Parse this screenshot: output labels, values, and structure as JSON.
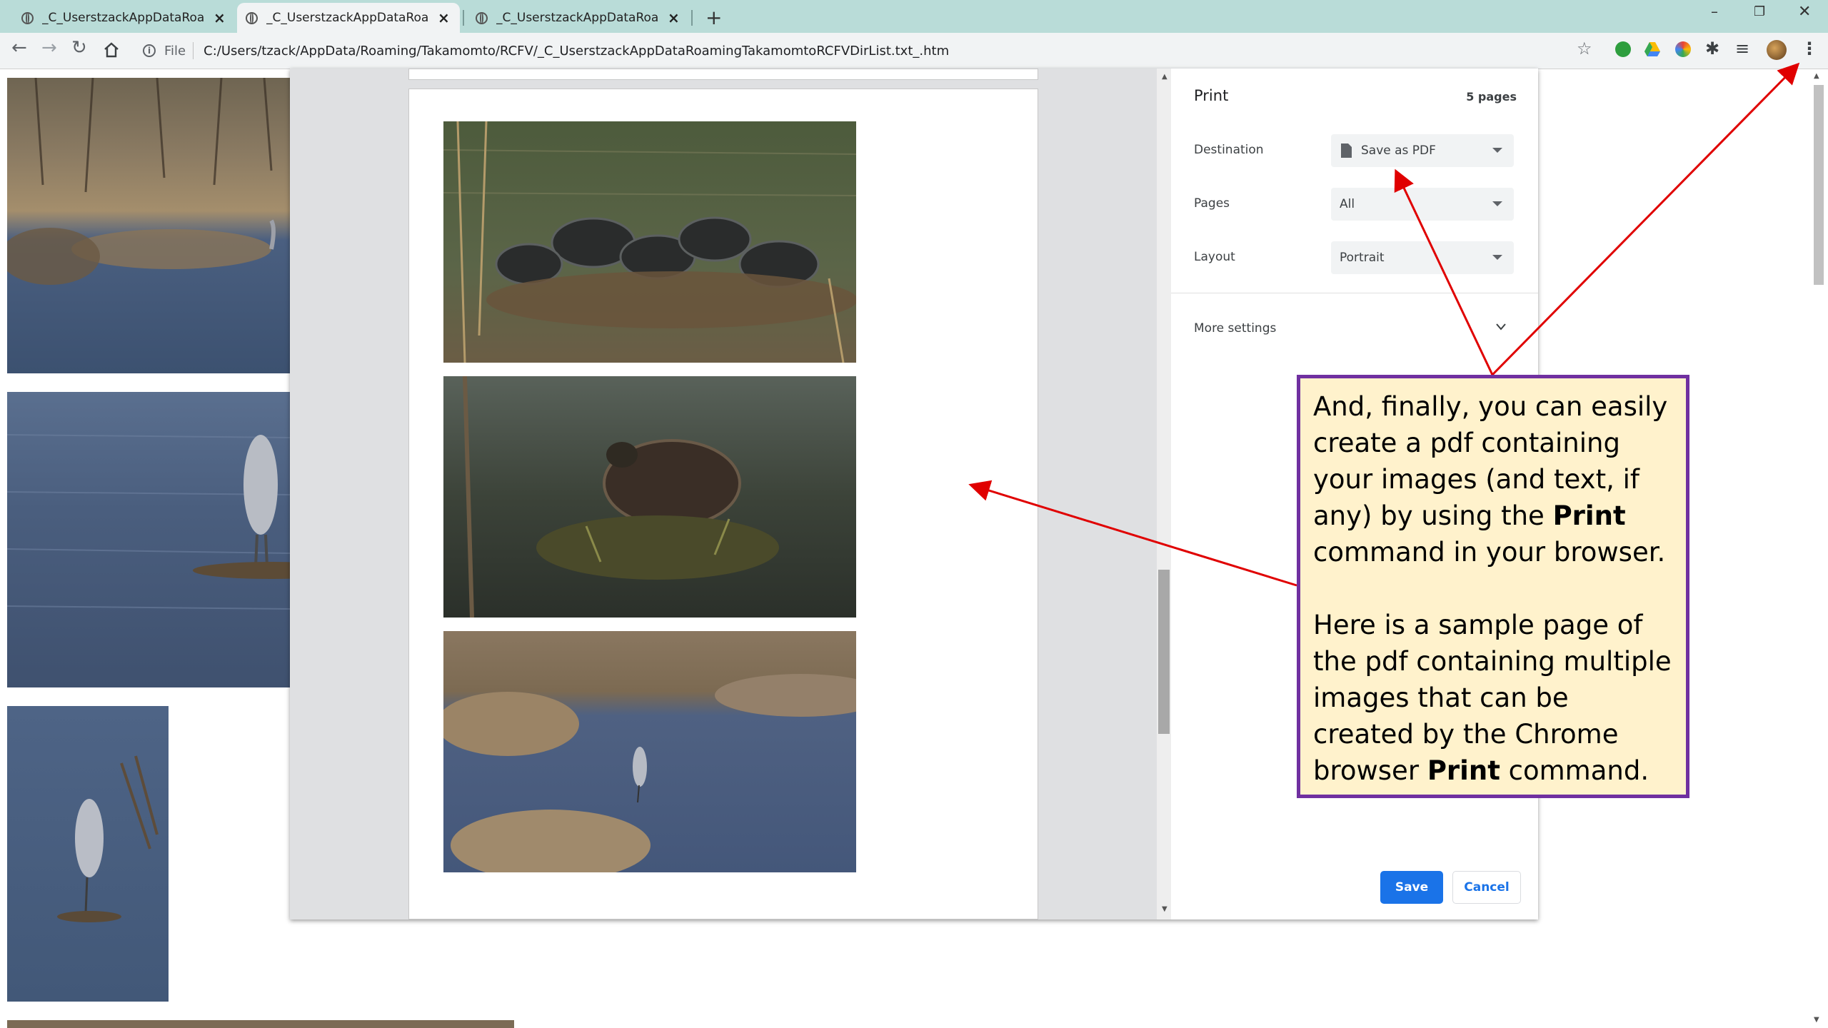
{
  "browser": {
    "tabs": [
      {
        "title": "_C_UserstzackAppDataRoamingT",
        "active": false
      },
      {
        "title": "_C_UserstzackAppDataRoamingT",
        "active": true
      },
      {
        "title": "_C_UserstzackAppDataRoamingT",
        "active": false
      }
    ],
    "address": {
      "scheme_label": "File",
      "url": "C:/Users/tzack/AppData/Roaming/Takamomto/RCFV/_C_UserstzackAppDataRoamingTakamomtoRCFVDirList.txt_.htm"
    }
  },
  "print_dialog": {
    "title": "Print",
    "page_count": "5 pages",
    "destination": {
      "label": "Destination",
      "value": "Save as PDF"
    },
    "pages": {
      "label": "Pages",
      "value": "All"
    },
    "layout": {
      "label": "Layout",
      "value": "Portrait"
    },
    "more_settings": "More settings",
    "save_label": "Save",
    "cancel_label": "Cancel"
  },
  "callout": {
    "line1": "And, finally, you can easily create a pdf containing your images (and text, if any) by using the ",
    "bold1": "Print",
    "line1_end": " command in your browser.",
    "line2": "Here is a sample page of the pdf containing multiple images that can be created by the Chrome browser ",
    "bold2": "Print",
    "line2_end": " command."
  },
  "colors": {
    "tab_strip": "#b9dcd8",
    "callout_fill": "#fff2cc",
    "callout_border": "#7030a0",
    "arrow": "#e00000",
    "save_button": "#1a73e8"
  }
}
